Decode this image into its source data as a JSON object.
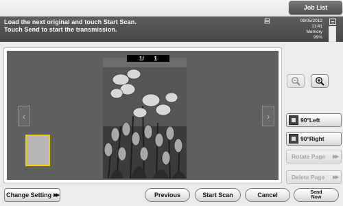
{
  "header": {
    "job_list_label": "Job List",
    "message_line1": "Load the next original and touch Start Scan.",
    "message_line2": "Touch Send to start the transmission.",
    "date": "09/05/2012",
    "time": "11:41",
    "memory_label": "Memory",
    "memory_value": "99%",
    "memory_fill_fraction": 0.99
  },
  "preview": {
    "page_current": "1/",
    "page_total": "1",
    "prev_arrow": "‹",
    "next_arrow": "›"
  },
  "side_controls": {
    "rotate_left_label": "90°Left",
    "rotate_right_label": "90°Right",
    "rotate_page_label": "Rotate Page",
    "delete_page_label": "Delete Page",
    "arrow": "▶▶"
  },
  "footer": {
    "change_setting_label": "Change Setting",
    "previous_label": "Previous",
    "start_scan_label": "Start Scan",
    "cancel_label": "Cancel",
    "send_now_line1": "Send",
    "send_now_line2": "Now"
  },
  "colors": {
    "message_bar": "#474747",
    "thumb_highlight": "#f0d000",
    "preview_bg": "#5f605f"
  },
  "icons": [
    "zoom-out-icon",
    "zoom-in-icon",
    "rotate-left-icon",
    "rotate-right-icon",
    "status-icon",
    "document-icon",
    "double-arrow-icon"
  ]
}
